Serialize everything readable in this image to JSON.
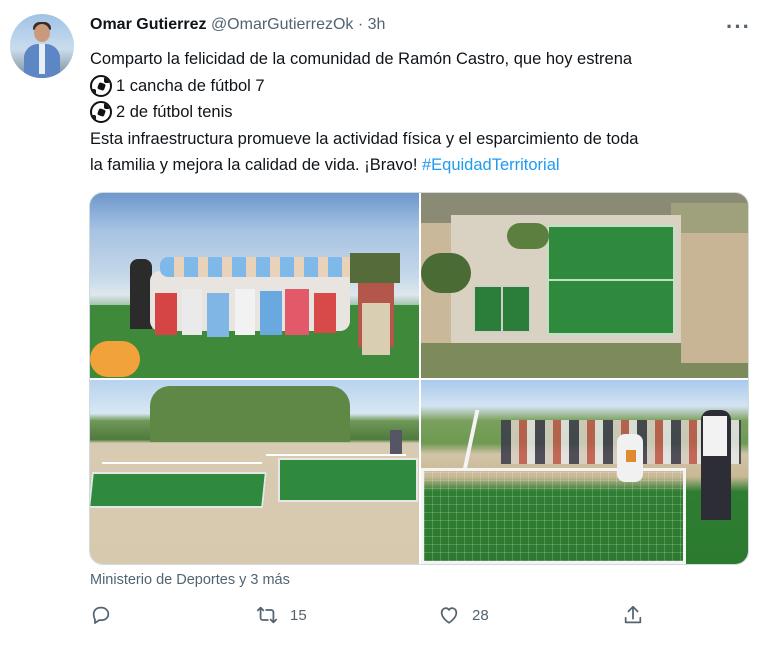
{
  "tweet": {
    "author_name": "Omar Gutierrez",
    "author_handle": "@OmarGutierrezOk",
    "separator": "·",
    "time": "3h",
    "more": "···",
    "text_line1": "Comparto la felicidad de la comunidad de Ramón Castro, que hoy estrena",
    "text_line2": "1 cancha de fútbol 7",
    "text_line3": "2 de fútbol tenis",
    "text_line4": "Esta infraestructura promueve la actividad física y el esparcimiento de toda",
    "text_line5": "la familia y mejora la calidad de vida. ¡Bravo! ",
    "hashtag": "#EquidadTerritorial",
    "emoji": "soccer-ball",
    "media_source": "Ministerio de Deportes y 3 más",
    "counts": {
      "reply": "",
      "retweet": "15",
      "like": "28",
      "share": ""
    }
  },
  "colors": {
    "text": "#0f1419",
    "secondary": "#536471",
    "link": "#1d9bf0",
    "border": "#cfd9de"
  },
  "icons": [
    "reply-icon",
    "retweet-icon",
    "like-icon",
    "share-icon",
    "more-icon"
  ]
}
